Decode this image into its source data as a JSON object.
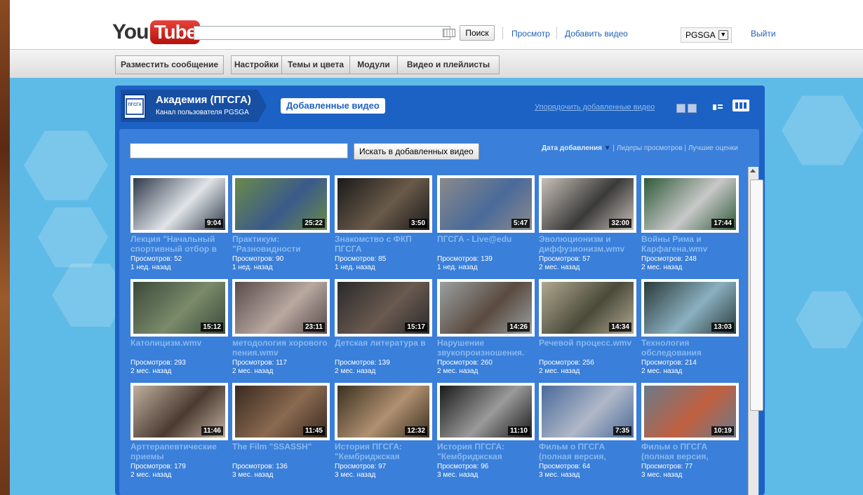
{
  "header": {
    "logo_you": "You",
    "logo_tube": "Tube",
    "search_button": "Поиск",
    "nav_browse": "Просмотр",
    "nav_upload": "Добавить видео",
    "username": "PGSGA",
    "logout": "Выйти"
  },
  "toolbar": {
    "post": "Разместить сообщение",
    "settings": "Настройки",
    "themes": "Темы и цвета",
    "modules": "Модули",
    "videos": "Видео и плейлисты"
  },
  "channel": {
    "title": "Академия (ПГСГА)",
    "subtitle": "Канал пользователя PGSGA",
    "logo_text": "ПГСГА",
    "tab_uploads": "Добавленные видео",
    "sort_link": "Упорядочить добавленные видео",
    "inner_search_button": "Искать в добавленных видео",
    "sort_active": "Дата добавления",
    "sort_views": "Лидеры просмотров",
    "sort_rating": "Лучшие оценки",
    "sort_sep": "|"
  },
  "colors": {
    "accent": "#1c62c4",
    "page_bg": "#5ebbe7",
    "link": "#1c62c4",
    "title_text": "#88b8ee"
  },
  "videos": [
    {
      "title": "Лекция \"Начальный спортивный отбор в",
      "duration": "9:04",
      "views": "Просмотров: 52",
      "age": "1 нед. назад",
      "thumb": [
        "#2e3a4a",
        "#e0e4e8"
      ]
    },
    {
      "title": "Практикум: \"Разновидности",
      "duration": "25:22",
      "views": "Просмотров: 90",
      "age": "1 нед. назад",
      "thumb": [
        "#6a8a4a",
        "#3a5a8a"
      ]
    },
    {
      "title": "Знакомство с ФКП ПГСГА",
      "duration": "3:50",
      "views": "Просмотров: 85",
      "age": "1 нед. назад",
      "thumb": [
        "#1a1a1a",
        "#6a5a4a"
      ]
    },
    {
      "title": "ПГСГА - Live@edu",
      "duration": "5:47",
      "views": "Просмотров: 139",
      "age": "1 нед. назад",
      "thumb": [
        "#8a8a8a",
        "#4a6a9a"
      ]
    },
    {
      "title": "Эволюционизм и диффузионизм.wmv",
      "duration": "32:00",
      "views": "Просмотров: 57",
      "age": "2 мес. назад",
      "thumb": [
        "#c8c0b8",
        "#3a3a3a"
      ]
    },
    {
      "title": "Войны Рима и Карфагена.wmv",
      "duration": "17:44",
      "views": "Просмотров: 248",
      "age": "2 мес. назад",
      "thumb": [
        "#2f5a3a",
        "#c8c8c8"
      ]
    },
    {
      "title": "Католицизм.wmv",
      "duration": "15:12",
      "views": "Просмотров: 293",
      "age": "2 мес. назад",
      "thumb": [
        "#3a4a3a",
        "#7a8a6a"
      ]
    },
    {
      "title": "методология хорового пения.wmv",
      "duration": "23:11",
      "views": "Просмотров: 117",
      "age": "2 мес. назад",
      "thumb": [
        "#5a4a4a",
        "#b8a8a0"
      ]
    },
    {
      "title": "Детская литература в",
      "duration": "15:17",
      "views": "Просмотров: 139",
      "age": "2 мес. назад",
      "thumb": [
        "#2a2a2a",
        "#6a5a50"
      ]
    },
    {
      "title": "Нарушение звукопроизношения.",
      "duration": "14:26",
      "views": "Просмотров: 260",
      "age": "2 мес. назад",
      "thumb": [
        "#9aa0a0",
        "#5a4a40"
      ]
    },
    {
      "title": "Речевой процесс.wmv",
      "duration": "14:34",
      "views": "Просмотров: 256",
      "age": "2 мес. назад",
      "thumb": [
        "#b0a890",
        "#4a4a3a"
      ]
    },
    {
      "title": "Технология обследования",
      "duration": "13:03",
      "views": "Просмотров: 214",
      "age": "2 мес. назад",
      "thumb": [
        "#2a3a3a",
        "#8ab0c0"
      ]
    },
    {
      "title": "Арттерапевтические приемы",
      "duration": "11:46",
      "views": "Просмотров: 179",
      "age": "2 мес. назад",
      "thumb": [
        "#c0b0a0",
        "#4a3a30"
      ]
    },
    {
      "title": "The Film \"SSASSH\"",
      "duration": "11:45",
      "views": "Просмотров: 136",
      "age": "3 мес. назад",
      "thumb": [
        "#3a2a20",
        "#8a6a50"
      ]
    },
    {
      "title": "История ПГСГА: \"Кембриджская",
      "duration": "12:32",
      "views": "Просмотров: 97",
      "age": "3 мес. назад",
      "thumb": [
        "#3a3020",
        "#b09070"
      ]
    },
    {
      "title": "История ПГСГА: \"Кембриджская",
      "duration": "11:10",
      "views": "Просмотров: 96",
      "age": "3 мес. назад",
      "thumb": [
        "#1a1a1a",
        "#9a9a9a"
      ]
    },
    {
      "title": "Фильм о ПГСГА (полная версия,",
      "duration": "7:35",
      "views": "Просмотров: 64",
      "age": "3 мес. назад",
      "thumb": [
        "#4a6a9a",
        "#b0b8c8"
      ]
    },
    {
      "title": "Фильм о ПГСГА (полная версия,",
      "duration": "10:19",
      "views": "Просмотров: 77",
      "age": "3 мес. назад",
      "thumb": [
        "#6a7a8a",
        "#c06040"
      ]
    }
  ]
}
